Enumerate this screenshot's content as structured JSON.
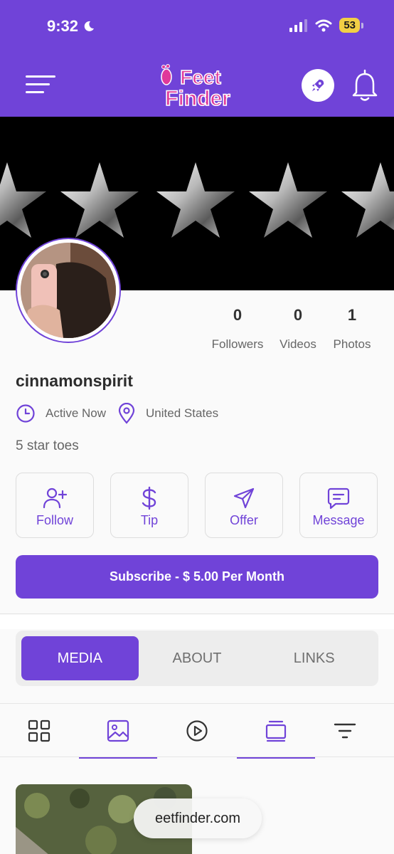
{
  "status_bar": {
    "time": "9:32",
    "battery": "53"
  },
  "brand": {
    "logo_line1": "Feet",
    "logo_line2": "Finder",
    "accent": "#7043d8",
    "logo_color": "#e0399a"
  },
  "profile": {
    "username": "cinnamonspirit",
    "active_status": "Active Now",
    "location": "United States",
    "bio": "5 star toes",
    "stats": [
      {
        "value": "0",
        "label": "Followers"
      },
      {
        "value": "0",
        "label": "Videos"
      },
      {
        "value": "1",
        "label": "Photos"
      }
    ]
  },
  "actions": [
    {
      "label": "Follow",
      "icon": "user-plus-icon"
    },
    {
      "label": "Tip",
      "icon": "dollar-icon"
    },
    {
      "label": "Offer",
      "icon": "send-icon"
    },
    {
      "label": "Message",
      "icon": "message-icon"
    }
  ],
  "subscribe": {
    "label": "Subscribe - $ 5.00 Per Month"
  },
  "tabs": [
    {
      "label": "MEDIA",
      "active": true
    },
    {
      "label": "ABOUT",
      "active": false
    },
    {
      "label": "LINKS",
      "active": false
    }
  ],
  "media_filters": [
    "grid-icon",
    "image-icon",
    "play-icon",
    "gallery-icon",
    "sort-icon"
  ],
  "browser": {
    "url": "eetfinder.com"
  }
}
